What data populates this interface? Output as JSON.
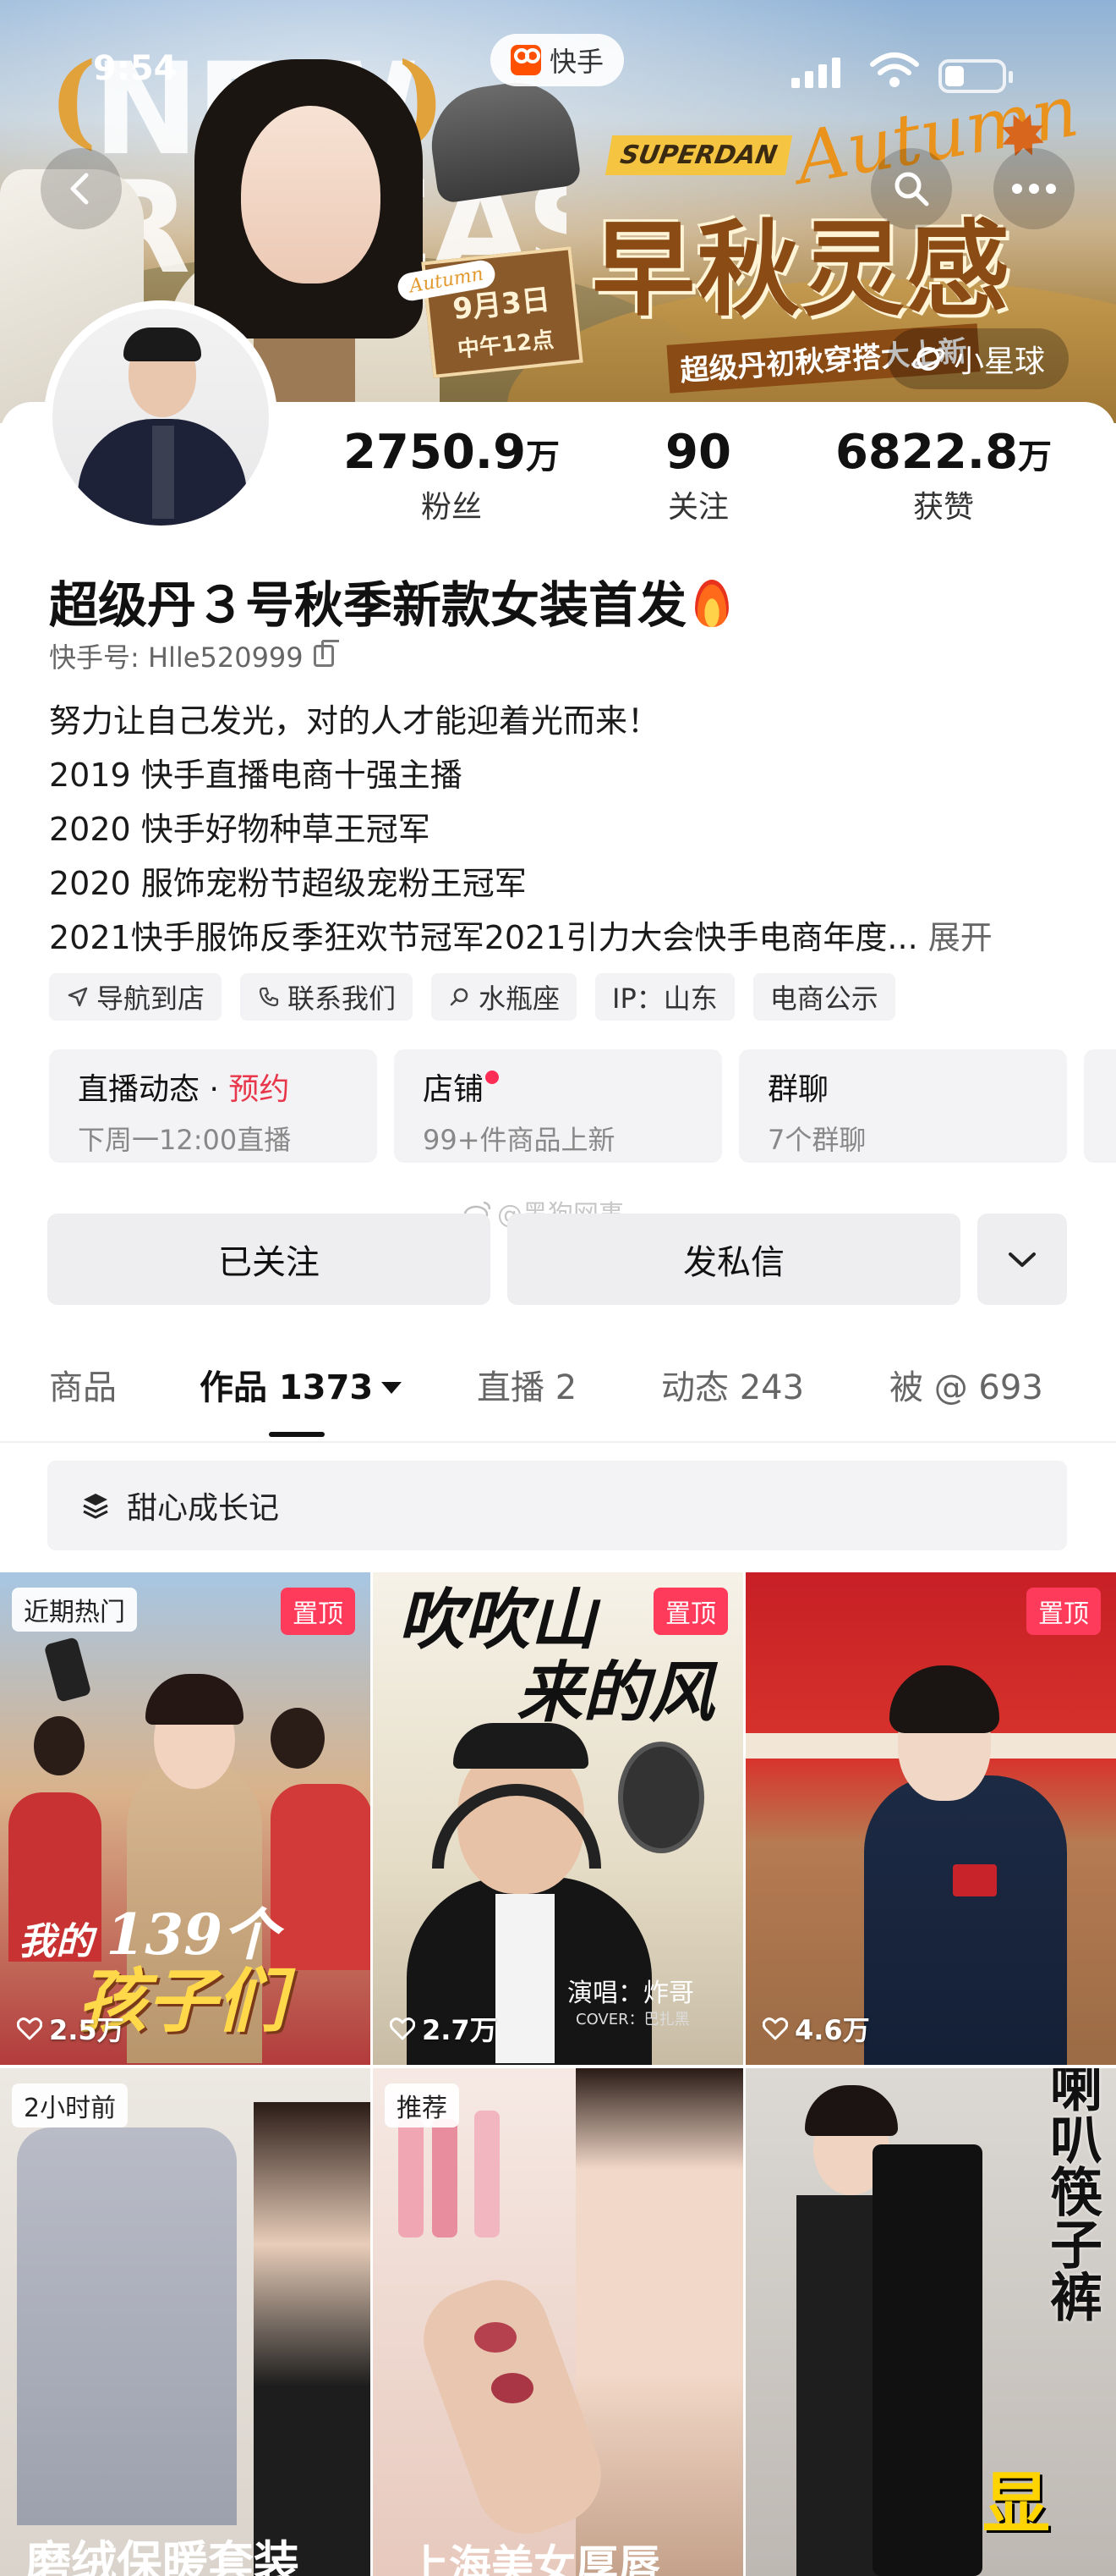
{
  "status": {
    "time": "9:54",
    "app_name": "快手"
  },
  "banner": {
    "headline": "NEW RELEASE",
    "superdan": "SUPERDAN",
    "autumn": "Autumn",
    "hero": "早秋灵感",
    "sub": "超级丹初秋穿搭大上新",
    "date_line1": "9月3日",
    "date_line2": "中午12点",
    "date_tag": "Autumn",
    "star_chip": "小星球"
  },
  "profile": {
    "stats": [
      {
        "num": "2750.9",
        "unit": "万",
        "label": "粉丝"
      },
      {
        "num": "90",
        "unit": "",
        "label": "关注"
      },
      {
        "num": "6822.8",
        "unit": "万",
        "label": "获赞"
      }
    ],
    "name": "超级丹３号秋季新款女装首发",
    "uid": "快手号: Hlle520999",
    "bio": [
      "努力让自己发光，对的人才能迎着光而来！",
      "2019 快手直播电商十强主播",
      "2020 快手好物种草王冠军",
      "2020 服饰宠粉节超级宠粉王冠军",
      "2021快手服饰反季狂欢节冠军2021引力大会快手电商年度..."
    ],
    "bio_expand": "展开",
    "tags": [
      {
        "icon": "navigation-icon",
        "label": "导航到店"
      },
      {
        "icon": "phone-icon",
        "label": "联系我们"
      },
      {
        "icon": "search-icon",
        "label": "水瓶座"
      },
      {
        "icon": "",
        "label": "IP：山东"
      },
      {
        "icon": "",
        "label": "电商公示"
      }
    ],
    "cards": [
      {
        "title": "直播动态 · ",
        "accent": "预约",
        "sub": "下周一12:00直播"
      },
      {
        "title": "店铺",
        "accent": "",
        "sub": "99+件商品上新"
      },
      {
        "title": "群聊",
        "accent": "",
        "sub": "7个群聊"
      }
    ],
    "watermark": "@黑狗网事",
    "follow_label": "已关注",
    "message_label": "发私信"
  },
  "tabs": [
    {
      "label": "商品"
    },
    {
      "label": "作品 1373"
    },
    {
      "label": "直播 2"
    },
    {
      "label": "动态 243"
    },
    {
      "label": "被 @ 693"
    }
  ],
  "collection": {
    "label": "甜心成长记"
  },
  "videos": [
    {
      "badge": "近期热门",
      "pinned": "置顶",
      "likes": "2.5万",
      "title1": "我的",
      "title2": "139个",
      "title3": "孩子们"
    },
    {
      "badge": "",
      "pinned": "置顶",
      "likes": "2.7万",
      "title1": "吹吹山",
      "title2": "来的风",
      "singer": "演唱：炸哥",
      "cover": "COVER：巴扎黑"
    },
    {
      "badge": "",
      "pinned": "置顶",
      "likes": "4.6万"
    },
    {
      "badge": "2小时前",
      "pinned": "",
      "likes": "",
      "title1": "磨绒保暖套装"
    },
    {
      "badge": "推荐",
      "pinned": "",
      "likes": "",
      "title1": "上海美女厚唇"
    },
    {
      "badge": "",
      "pinned": "",
      "likes": "",
      "title1": "喇叭筷子裤",
      "title2": "显"
    }
  ],
  "colors": {
    "accent": "#ff3b5c",
    "live_accent": "#e8374a",
    "chip_bg": "#f3f3f5"
  }
}
